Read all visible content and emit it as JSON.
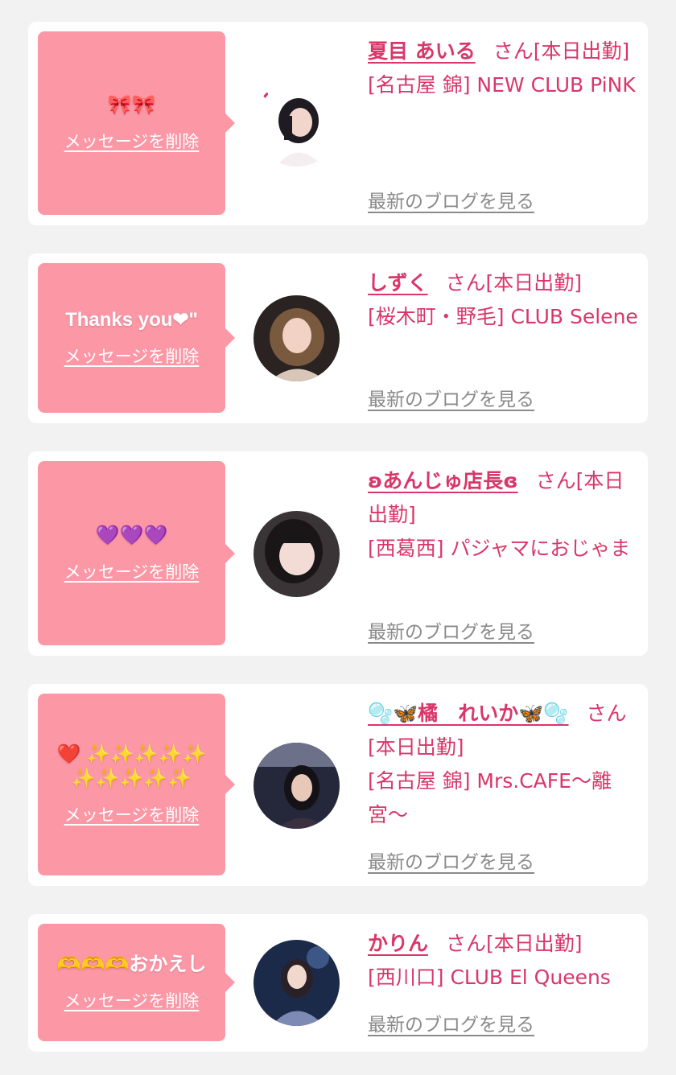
{
  "entries": [
    {
      "message": "🎀🎀",
      "delete_label": "メッセージを削除",
      "name": "夏目 あいる",
      "suffix": "さん[本日出勤]",
      "store": "[名古屋 錦] NEW CLUB PiNK",
      "blog_label": "最新のブログを見る"
    },
    {
      "message": "Thanks you❤\"",
      "delete_label": "メッセージを削除",
      "name": "しずく",
      "suffix": "さん[本日出勤]",
      "store": "[桜木町・野毛] CLUB Selene",
      "blog_label": "最新のブログを見る"
    },
    {
      "message": "💜💜💜",
      "delete_label": "メッセージを削除",
      "name": "ʚあんじゅ店長ɞ",
      "suffix": "さん[本日出勤]",
      "store": "[西葛西] パジャマにおじゃま",
      "blog_label": "最新のブログを見る"
    },
    {
      "message": "❤️ ✨✨✨✨✨✨✨✨✨✨",
      "delete_label": "メッセージを削除",
      "name": "🫧🦋橘　れいか🦋🫧",
      "suffix": "さん[本日出勤]",
      "store": "[名古屋 錦] Mrs.CAFE〜離宮〜",
      "blog_label": "最新のブログを見る"
    },
    {
      "message": "🫶🫶🫶おかえし",
      "delete_label": "メッセージを削除",
      "name": "かりん",
      "suffix": "さん[本日出勤]",
      "store": "[西川口] CLUB El Queens",
      "blog_label": "最新のブログを見る"
    }
  ]
}
